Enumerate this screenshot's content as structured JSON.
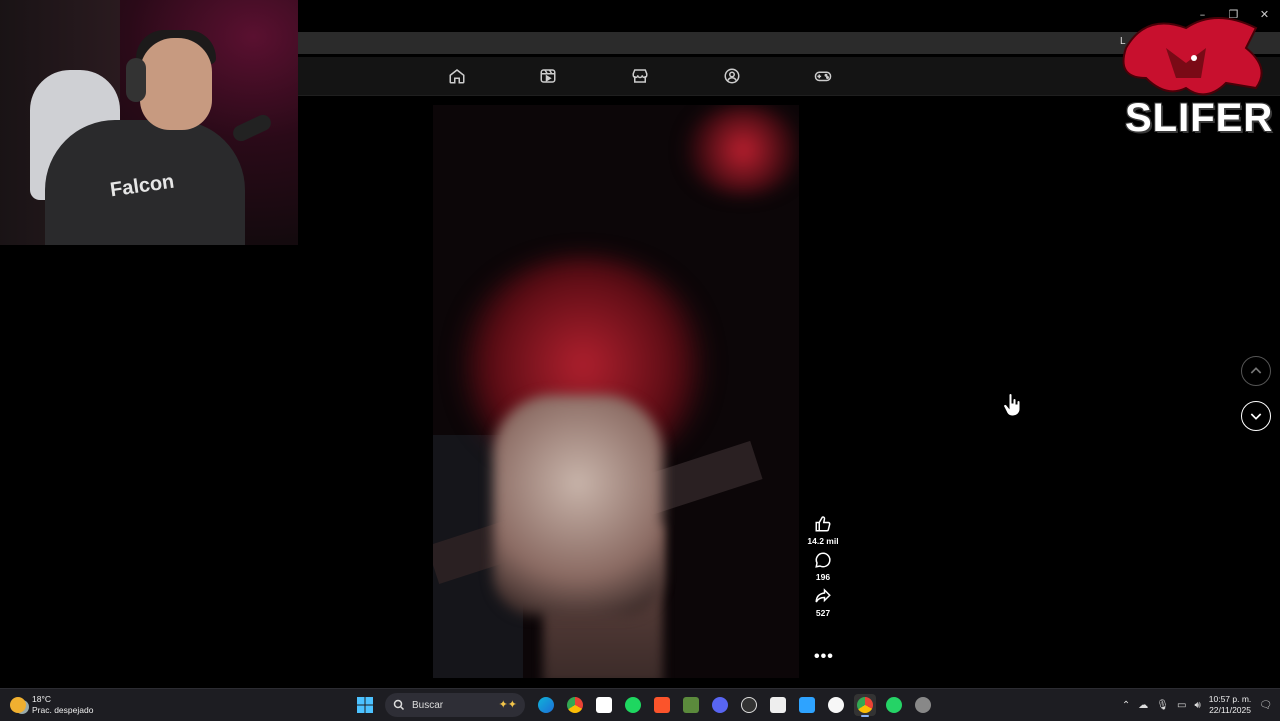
{
  "browser": {
    "address_text": "L",
    "window_controls": [
      "–",
      "❐",
      "✕"
    ],
    "nav_icons": [
      "home-icon",
      "reels-icon",
      "marketplace-icon",
      "groups-icon",
      "gaming-icon"
    ]
  },
  "overlay": {
    "brand": "SLIFER",
    "webcam_shirt_text": "Falcon"
  },
  "video": {
    "likes": "14.2 mil",
    "comments": "196",
    "shares": "527",
    "more": "•••"
  },
  "taskbar": {
    "weather_temp": "18°C",
    "weather_desc": "Prac. despejado",
    "search_label": "Buscar",
    "time": "10:57 p. m.",
    "date": "22/11/2025",
    "apps": [
      "edge",
      "chrome",
      "capcut",
      "spotify",
      "brave",
      "minecraft",
      "discord",
      "obs",
      "store",
      "onedrive",
      "itunes",
      "chrome-active",
      "whatsapp",
      "settings"
    ]
  },
  "colors": {
    "accent": "#c8102e",
    "taskbar_bg": "#1d1d22",
    "navbar_bg": "#141414"
  }
}
